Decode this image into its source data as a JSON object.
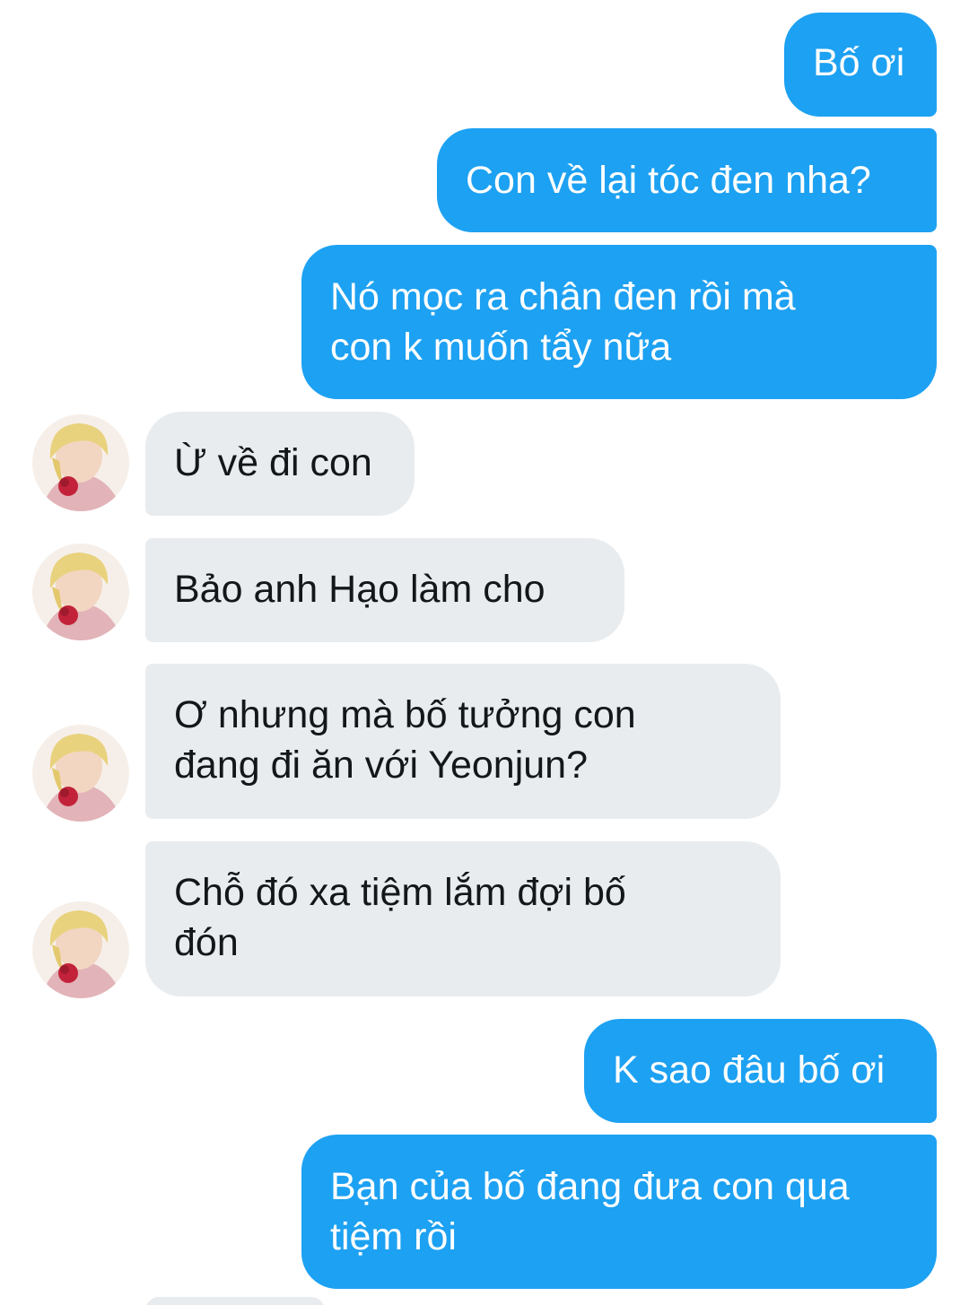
{
  "colors": {
    "sent_bubble": "#1da1f2",
    "received_bubble": "#e9ecef",
    "sent_text": "#ffffff",
    "received_text": "#14171a"
  },
  "messages": [
    {
      "side": "sent",
      "text": "Bố ơi"
    },
    {
      "side": "sent",
      "text": "Con về lại tóc đen nha?"
    },
    {
      "side": "sent",
      "text": "Nó mọc ra chân đen rồi mà\ncon k muốn tẩy nữa"
    },
    {
      "side": "received",
      "text": "Ừ về đi con",
      "avatar": "contact-avatar"
    },
    {
      "side": "received",
      "text": "Bảo anh Hạo làm cho",
      "avatar": "contact-avatar"
    },
    {
      "side": "received",
      "text": "Ơ nhưng mà bố tưởng con\nđang đi ăn với Yeonjun?",
      "avatar": "contact-avatar"
    },
    {
      "side": "received",
      "text": "Chỗ đó xa tiệm lắm đợi bố\nđón",
      "avatar": "contact-avatar"
    },
    {
      "side": "sent",
      "text": "K sao đâu bố ơi"
    },
    {
      "side": "sent",
      "text": "Bạn của bố đang đưa con qua\ntiệm rồi"
    }
  ]
}
